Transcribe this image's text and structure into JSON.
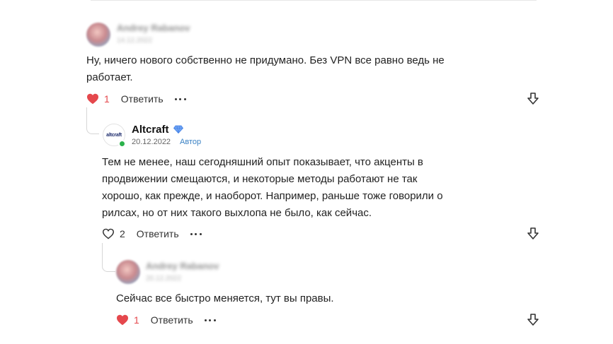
{
  "comments": [
    {
      "author": "Andrey Rabanov",
      "date": "14.12.2022",
      "text_lines": [
        "Ну, ничего нового собственно не придумано. Без VPN все равно ведь не",
        "работает."
      ],
      "likes": "1",
      "liked": true,
      "reply_label": "Ответить"
    },
    {
      "author": "Altcraft",
      "avatar_text": "altcraft",
      "date": "20.12.2022",
      "badge": "Автор",
      "text_lines": [
        "Тем не менее, наш сегодняшний опыт показывает, что акценты в",
        "продвижении смещаются, и некоторые методы работают не так",
        "хорошо, как прежде, и наоборот. Например, раньше тоже говорили о",
        "рилсах, но от них такого выхлопа не было, как сейчас."
      ],
      "likes": "2",
      "liked": false,
      "reply_label": "Ответить"
    },
    {
      "author": "Andrey Rabanov",
      "date": "20.12.2022",
      "text_lines": [
        "Сейчас все быстро меняется, тут вы правы."
      ],
      "likes": "1",
      "liked": true,
      "reply_label": "Ответить"
    }
  ],
  "colors": {
    "like_red": "#e5484d",
    "author_badge": "#3b82c4",
    "online": "#2bb24c"
  },
  "icons": [
    "heart-icon",
    "heart-outline-icon",
    "more-dots-icon",
    "share-icon",
    "diamond-icon"
  ]
}
